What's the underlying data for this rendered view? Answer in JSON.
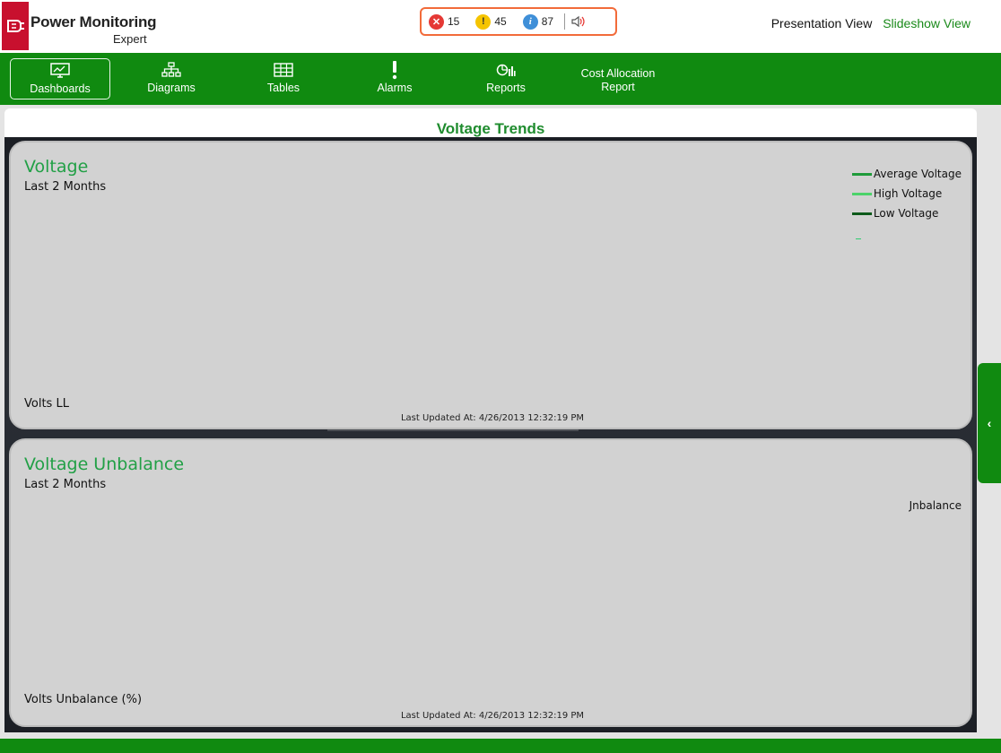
{
  "app": {
    "title": "Power Monitoring",
    "subtitle": "Expert"
  },
  "alarms": {
    "high_count": "15",
    "medium_count": "45",
    "low_count": "87",
    "high_icon": "x-circle-icon",
    "medium_icon": "exclamation-circle-icon",
    "low_icon": "info-circle-icon",
    "sound_icon": "speaker-icon"
  },
  "views": {
    "presentation": "Presentation View",
    "slideshow": "Slideshow View"
  },
  "nav": {
    "items": [
      {
        "label": "Dashboards",
        "icon": "dashboard-monitor-icon",
        "active": true
      },
      {
        "label": "Diagrams",
        "icon": "hierarchy-icon",
        "active": false
      },
      {
        "label": "Tables",
        "icon": "table-grid-icon",
        "active": false
      },
      {
        "label": "Alarms",
        "icon": "exclamation-icon",
        "active": false
      },
      {
        "label": "Reports",
        "icon": "report-chart-icon",
        "active": false
      },
      {
        "label": "Cost Allocation\nReport",
        "icon": "",
        "active": false
      }
    ]
  },
  "page": {
    "title": "Voltage Trends"
  },
  "panels": {
    "voltage": {
      "title": "Voltage",
      "period": "Last 2 Months",
      "axis_label": "Volts LL",
      "updated": "Last Updated At: 4/26/2013 12:32:19 PM",
      "legend": [
        {
          "label": "Average Voltage",
          "color": "#1f9b3a"
        },
        {
          "label": "High Voltage",
          "color": "#4cd36a"
        },
        {
          "label": "Low Voltage",
          "color": "#0d5a1a"
        }
      ]
    },
    "unbalance": {
      "title": "Voltage Unbalance",
      "period": "Last 2 Months",
      "axis_label": "Volts Unbalance (%)",
      "updated": "Last Updated At: 4/26/2013 12:32:19 PM",
      "legend_label": "Jnbalance"
    }
  },
  "side_tab": {
    "icon": "chevron-left-icon",
    "glyph": "‹"
  },
  "colors": {
    "brand_green": "#108a10",
    "title_green": "#22a046",
    "logo_red": "#c8102e",
    "alarm_border": "#f26b3a"
  }
}
